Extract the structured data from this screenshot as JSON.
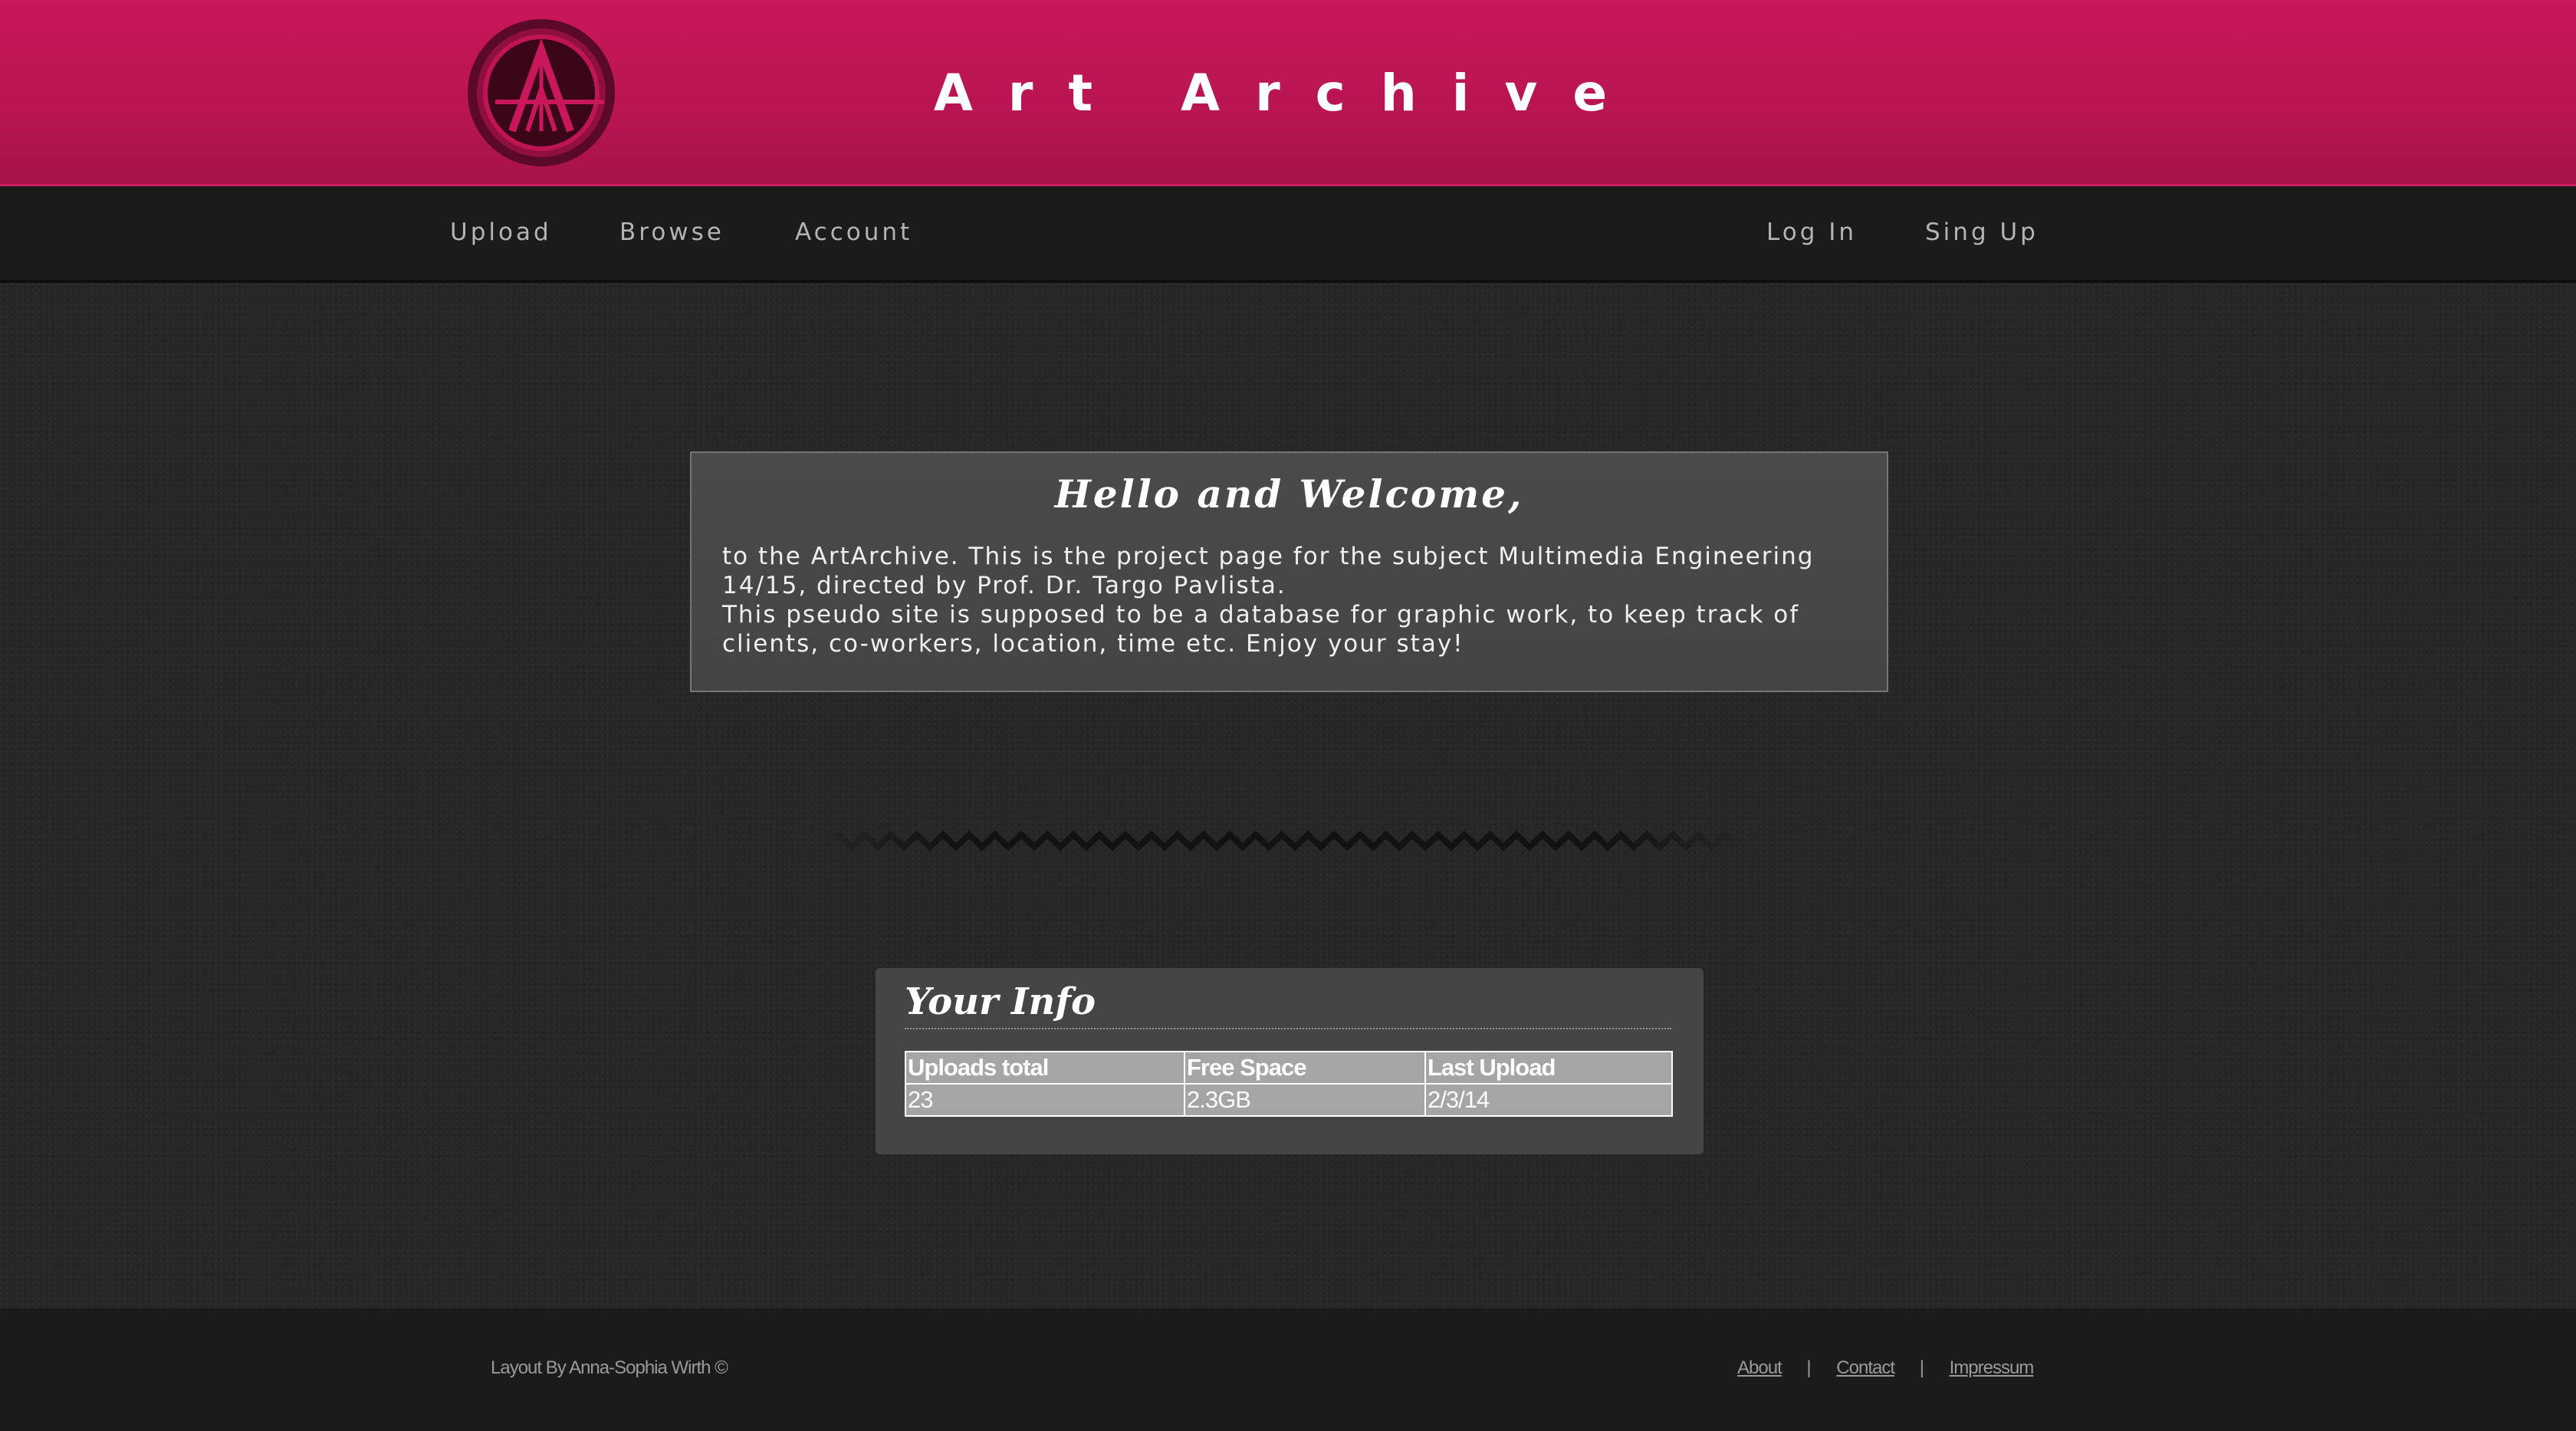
{
  "header": {
    "title": "Art Archive"
  },
  "nav": {
    "left": [
      "Upload",
      "Browse",
      "Account"
    ],
    "right": [
      "Log In",
      "Sing Up"
    ]
  },
  "welcome": {
    "title": "Hello and Welcome,",
    "line1": "to the ArtArchive. This is the project page for the subject Multimedia Engineering 14/15, directed by Prof. Dr. Targo Pavlista.",
    "line2": "This pseudo site is supposed to be a database for graphic work, to keep track of clients, co-workers, location, time etc. Enjoy your stay!"
  },
  "info": {
    "title": "Your Info",
    "headers": [
      "Uploads total",
      "Free Space",
      "Last Upload"
    ],
    "values": [
      "23",
      "2.3GB",
      "2/3/14"
    ]
  },
  "footer": {
    "credit": "Layout By Anna-Sophia Wirth ©",
    "links": [
      "About",
      "Contact",
      "Impressum"
    ],
    "separator": "|"
  },
  "colors": {
    "brand": "#c8175a",
    "nav_bg": "#1b1b1b",
    "body_bg": "#272727",
    "panel_bg": "#454545"
  }
}
